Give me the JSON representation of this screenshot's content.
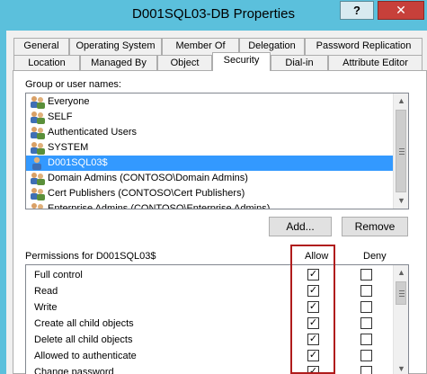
{
  "window": {
    "title": "D001SQL03-DB Properties",
    "help_label": "?",
    "close_label": "✕"
  },
  "tabs_row1": [
    "General",
    "Operating System",
    "Member Of",
    "Delegation",
    "Password Replication"
  ],
  "tabs_row2": [
    "Location",
    "Managed By",
    "Object",
    "Security",
    "Dial-in",
    "Attribute Editor"
  ],
  "active_tab": "Security",
  "security": {
    "group_label": "Group or user names:",
    "users": [
      {
        "name": "Everyone",
        "icon": "group-icon",
        "selected": false
      },
      {
        "name": "SELF",
        "icon": "group-icon",
        "selected": false
      },
      {
        "name": "Authenticated Users",
        "icon": "group-icon",
        "selected": false
      },
      {
        "name": "SYSTEM",
        "icon": "group-icon",
        "selected": false
      },
      {
        "name": "D001SQL03$",
        "icon": "user-icon",
        "selected": true
      },
      {
        "name": "Domain Admins (CONTOSO\\Domain Admins)",
        "icon": "group-icon",
        "selected": false
      },
      {
        "name": "Cert Publishers (CONTOSO\\Cert Publishers)",
        "icon": "group-icon",
        "selected": false
      },
      {
        "name": "Enterprise Admins (CONTOSO\\Enterprise Admins)",
        "icon": "group-icon",
        "selected": false
      }
    ],
    "add_label": "Add...",
    "remove_label": "Remove",
    "permissions_label": "Permissions for D001SQL03$",
    "allow_header": "Allow",
    "deny_header": "Deny",
    "permissions": [
      {
        "name": "Full control",
        "allow": true,
        "deny": false
      },
      {
        "name": "Read",
        "allow": true,
        "deny": false
      },
      {
        "name": "Write",
        "allow": true,
        "deny": false
      },
      {
        "name": "Create all child objects",
        "allow": true,
        "deny": false
      },
      {
        "name": "Delete all child objects",
        "allow": true,
        "deny": false
      },
      {
        "name": "Allowed to authenticate",
        "allow": true,
        "deny": false
      },
      {
        "name": "Change password",
        "allow": true,
        "deny": false
      }
    ]
  },
  "colors": {
    "titlebar": "#5bc0dc",
    "selection": "#3399ff",
    "highlight_box": "#b01c1c",
    "close_button": "#c7403a"
  }
}
